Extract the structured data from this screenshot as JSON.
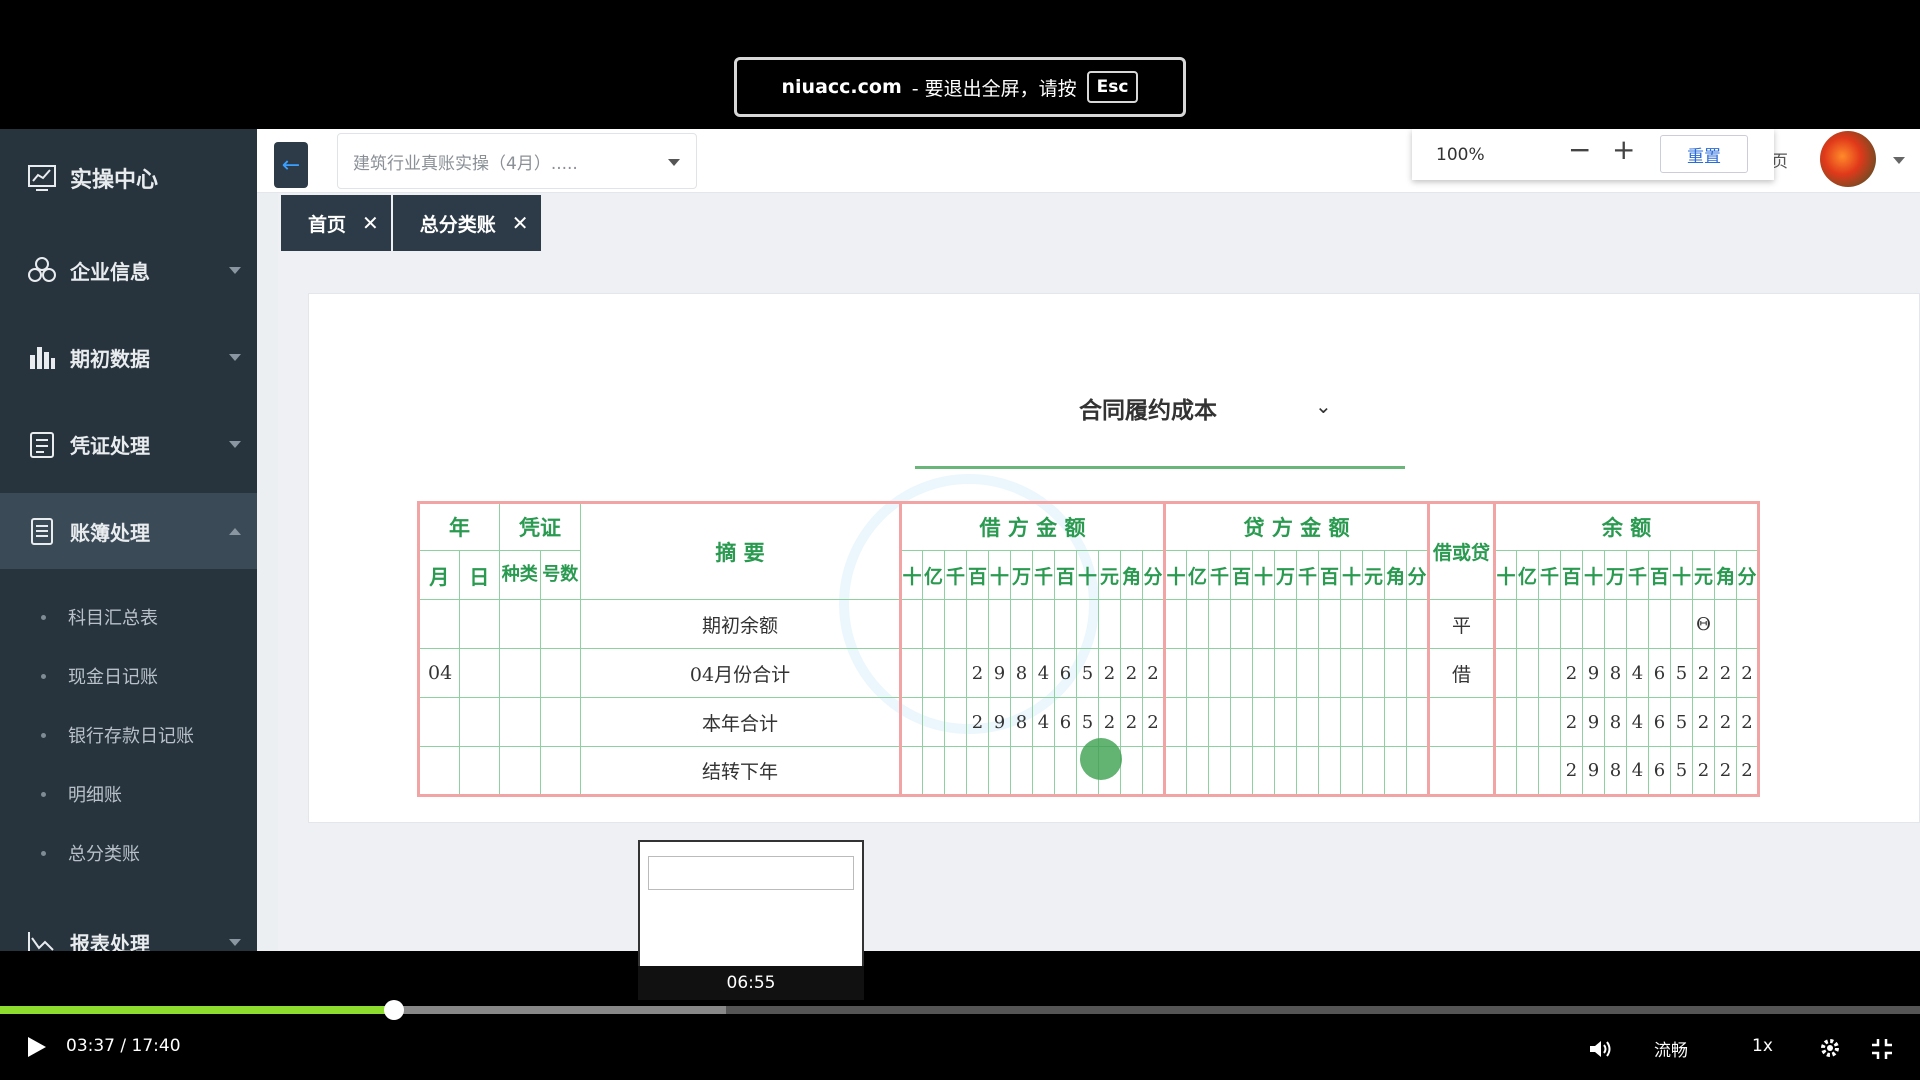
{
  "fullscreen_notice": {
    "site": "niuacc.com",
    "message": "-  要退出全屏，请按",
    "key": "Esc"
  },
  "sidebar": {
    "items": [
      {
        "label": "实操中心",
        "icon": "chart-monitor-icon"
      },
      {
        "label": "企业信息",
        "icon": "company-icon"
      },
      {
        "label": "期初数据",
        "icon": "bar-chart-icon"
      },
      {
        "label": "凭证处理",
        "icon": "voucher-icon"
      },
      {
        "label": "账簿处理",
        "icon": "ledger-book-icon"
      },
      {
        "label": "报表处理",
        "icon": "line-chart-icon"
      }
    ],
    "sub_items": [
      {
        "label": "科目汇总表"
      },
      {
        "label": "现金日记账"
      },
      {
        "label": "银行存款日记账"
      },
      {
        "label": "明细账"
      },
      {
        "label": "总分类账"
      }
    ]
  },
  "topbar": {
    "company_select": "建筑行业真账实操（4月）.....",
    "zoom": "100%",
    "zoom_minus": "−",
    "zoom_plus": "+",
    "zoom_reset": "重置",
    "page_fragment": "页"
  },
  "tabs": [
    {
      "label": "首页"
    },
    {
      "label": "总分类账"
    }
  ],
  "ledger": {
    "account": "合同履约成本",
    "headers": {
      "year": "年",
      "voucher": "凭证",
      "summary": "摘 要",
      "debit": "借 方 金 额",
      "credit": "贷 方 金 额",
      "direction": "借或贷",
      "balance": "余 额",
      "month": "月",
      "day": "日",
      "kind": "种类",
      "number": "号数"
    },
    "digit_units": [
      "十",
      "亿",
      "千",
      "百",
      "十",
      "万",
      "千",
      "百",
      "十",
      "元",
      "角",
      "分"
    ],
    "rows": [
      {
        "month": "",
        "summary": "期初余额",
        "debit": "",
        "credit": "",
        "direction": "平",
        "balance": "Θ"
      },
      {
        "month": "04",
        "summary": "04月份合计",
        "debit": "298465222",
        "credit": "",
        "direction": "借",
        "balance": "298465222"
      },
      {
        "month": "",
        "summary": "本年合计",
        "debit": "298465222",
        "credit": "",
        "direction": "",
        "balance": "298465222"
      },
      {
        "month": "",
        "summary": "结转下年",
        "debit": "",
        "credit": "",
        "direction": "",
        "balance": "298465222"
      }
    ]
  },
  "video": {
    "preview_time": "06:55",
    "current_time": "03:37",
    "duration": "17:40",
    "time_display": "03:37 / 17:40",
    "played_fraction": 0.205,
    "buffered_fraction": 0.378,
    "quality": "流畅",
    "speed": "1x"
  }
}
